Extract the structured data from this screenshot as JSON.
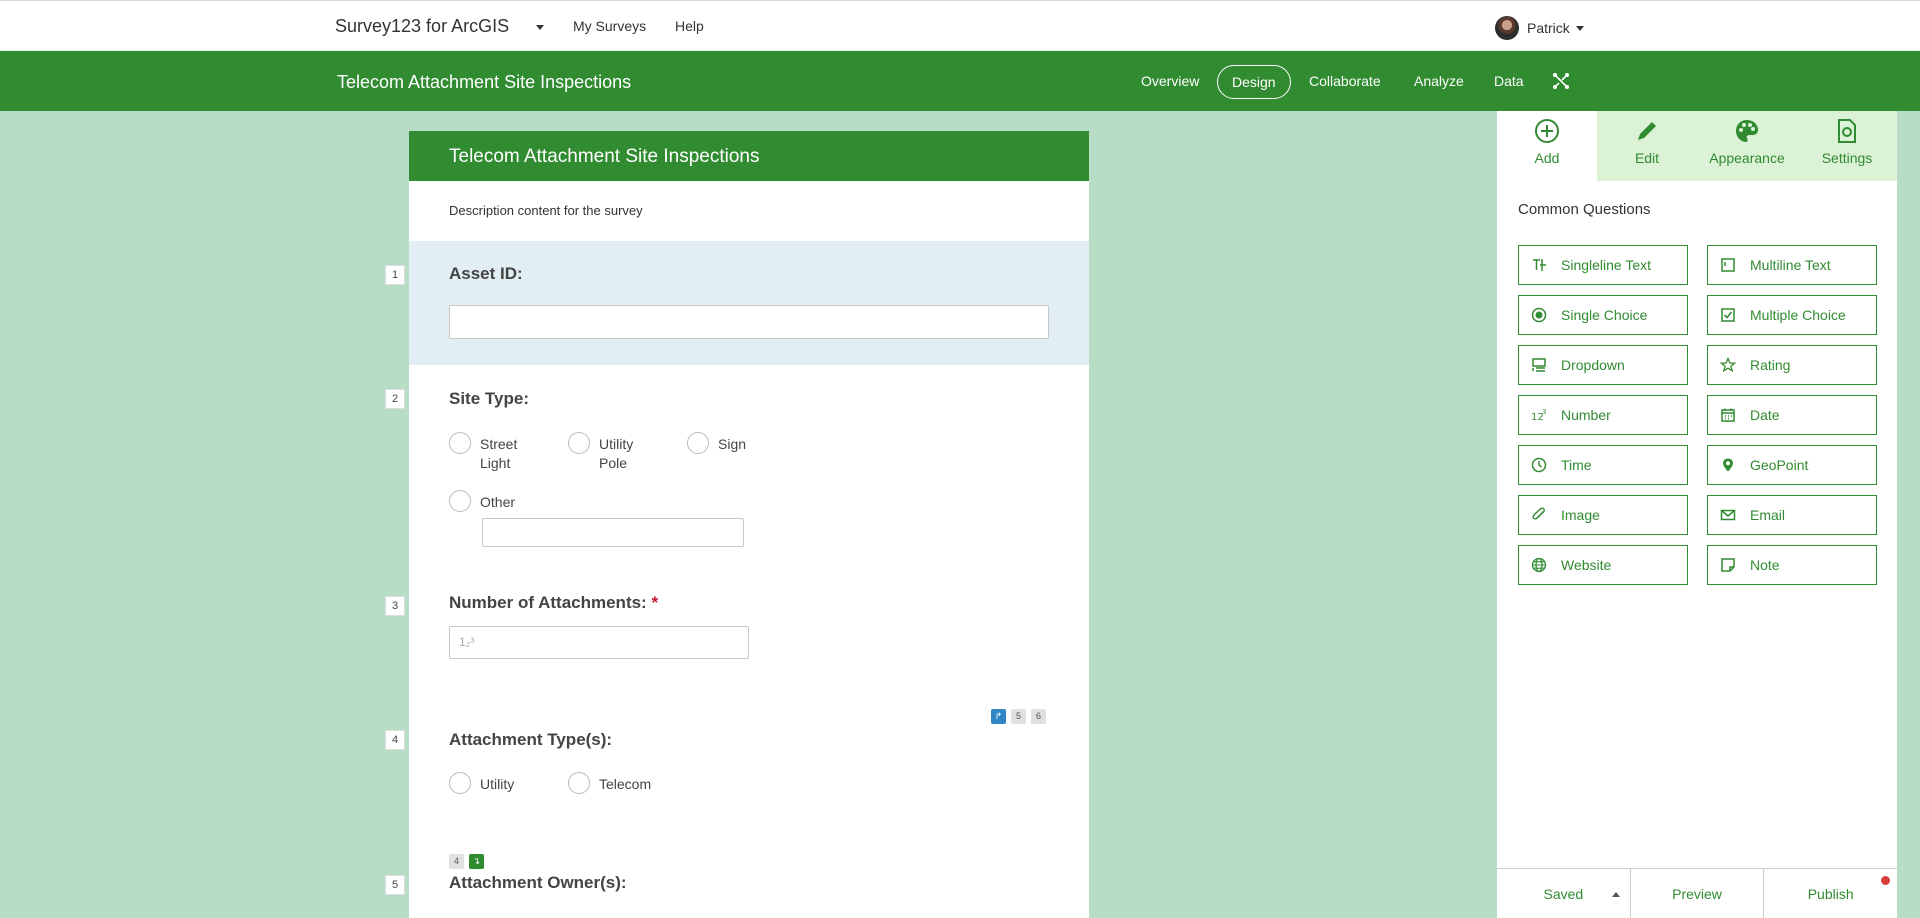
{
  "topnav": {
    "app_title": "Survey123 for ArcGIS",
    "links": [
      "My Surveys",
      "Help"
    ],
    "user_name": "Patrick"
  },
  "header": {
    "survey_title": "Telecom Attachment Site Inspections",
    "tabs": [
      "Overview",
      "Design",
      "Collaborate",
      "Analyze",
      "Data"
    ],
    "active_tab": "Design"
  },
  "form": {
    "title": "Telecom Attachment Site Inspections",
    "description": "Description content for the survey",
    "questions": [
      {
        "number": "1",
        "label": "Asset ID:"
      },
      {
        "number": "2",
        "label": "Site Type:",
        "options": [
          "Street Light",
          "Utility Pole",
          "Sign",
          "Other"
        ]
      },
      {
        "number": "3",
        "label": "Number of Attachments:",
        "required_mark": "*",
        "placeholder_icon": "1₂³"
      },
      {
        "number": "4",
        "label": "Attachment Type(s):",
        "options": [
          "Utility",
          "Telecom"
        ],
        "rule_targets": [
          "5",
          "6"
        ]
      },
      {
        "number": "5",
        "label": "Attachment Owner(s):",
        "rule_source": "4"
      }
    ]
  },
  "panel": {
    "tabs": [
      "Add",
      "Edit",
      "Appearance",
      "Settings"
    ],
    "active_tab": "Add",
    "section_title": "Common Questions",
    "question_types": [
      {
        "label": "Singleline Text",
        "icon": "singleline-text-icon"
      },
      {
        "label": "Multiline Text",
        "icon": "multiline-text-icon"
      },
      {
        "label": "Single Choice",
        "icon": "radio-icon"
      },
      {
        "label": "Multiple Choice",
        "icon": "checkbox-icon"
      },
      {
        "label": "Dropdown",
        "icon": "dropdown-icon"
      },
      {
        "label": "Rating",
        "icon": "star-icon"
      },
      {
        "label": "Number",
        "icon": "number-icon"
      },
      {
        "label": "Date",
        "icon": "calendar-icon"
      },
      {
        "label": "Time",
        "icon": "clock-icon"
      },
      {
        "label": "GeoPoint",
        "icon": "map-pin-icon"
      },
      {
        "label": "Image",
        "icon": "paperclip-icon"
      },
      {
        "label": "Email",
        "icon": "envelope-icon"
      },
      {
        "label": "Website",
        "icon": "globe-icon"
      },
      {
        "label": "Note",
        "icon": "note-icon"
      }
    ],
    "footer": {
      "saved": "Saved",
      "preview": "Preview",
      "publish": "Publish"
    }
  },
  "colors": {
    "brand_green": "#318b31",
    "canvas_bg": "#b7ddc6",
    "active_question_bg": "#e1eef3",
    "required_red": "#c8102e"
  }
}
